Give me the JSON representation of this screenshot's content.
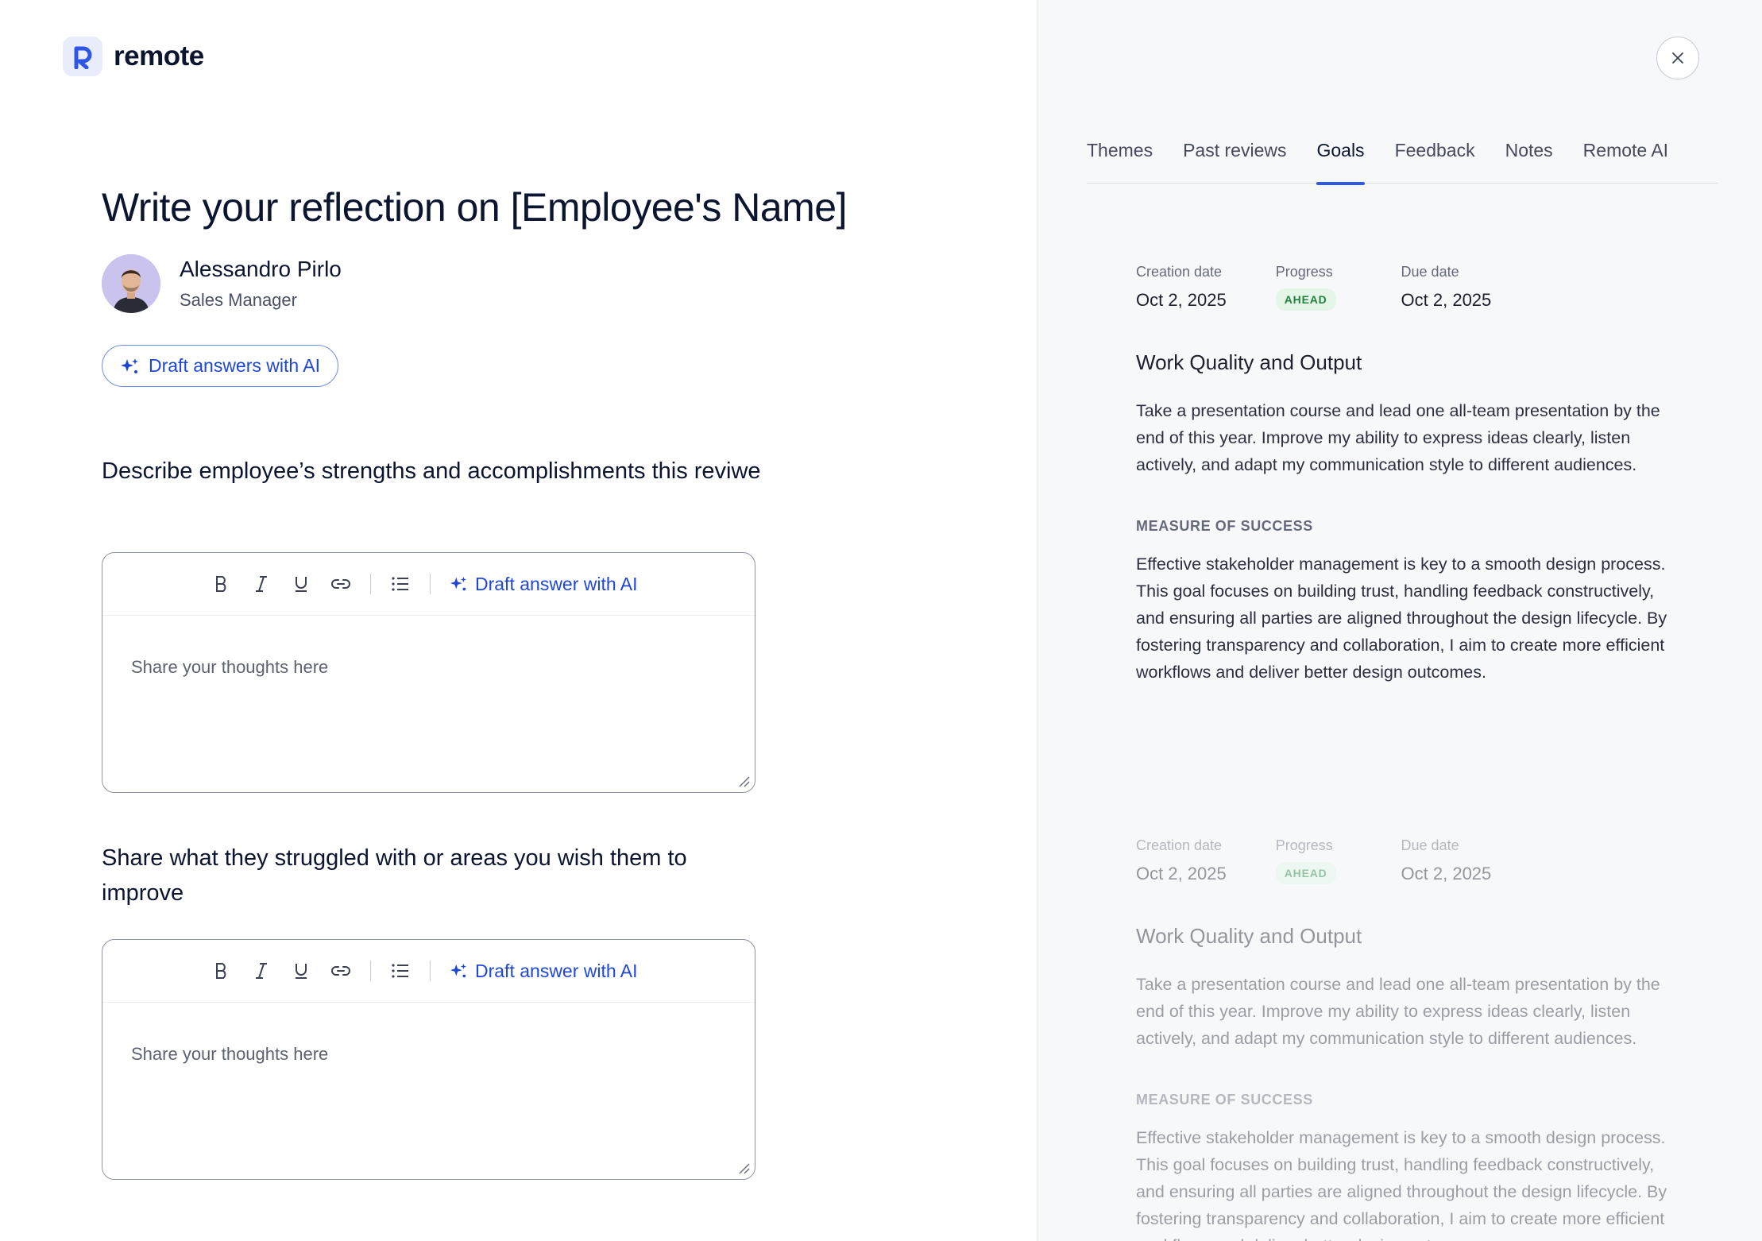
{
  "app": {
    "logo_text": "remote"
  },
  "page": {
    "title": "Write your reflection on [Employee's Name]"
  },
  "employee": {
    "name": "Alessandro Pirlo",
    "role": "Sales Manager"
  },
  "draft_all_button": {
    "label": "Draft answers with AI"
  },
  "questions": [
    {
      "text": "Describe employee’s strengths and accomplishments this reviwe",
      "editor": {
        "placeholder": "Share your thoughts here",
        "ai_label": "Draft answer with AI"
      }
    },
    {
      "text": "Share what they struggled with or areas you wish them to improve",
      "editor": {
        "placeholder": "Share your thoughts here",
        "ai_label": "Draft answer with AI"
      }
    }
  ],
  "side_panel": {
    "tabs": [
      {
        "label": "Themes",
        "active": false
      },
      {
        "label": "Past reviews",
        "active": false
      },
      {
        "label": "Goals",
        "active": true
      },
      {
        "label": "Feedback",
        "active": false
      },
      {
        "label": "Notes",
        "active": false
      },
      {
        "label": "Remote AI",
        "active": false
      }
    ],
    "goals": [
      {
        "creation_label": "Creation date",
        "creation_date": "Oct 2, 2025",
        "progress_label": "Progress",
        "progress_status": "AHEAD",
        "due_label": "Due date",
        "due_date": "Oct 2, 2025",
        "title": "Work Quality and Output",
        "description": "Take a presentation course and lead one all-team presentation by the end of this year.  Improve my ability to express ideas clearly, listen actively, and adapt my communication style to different audiences.",
        "measure_label": "MEASURE OF SUCCESS",
        "measure_text": "Effective stakeholder management is key to a smooth design process. This goal focuses on building trust, handling feedback constructively, and ensuring all parties are aligned throughout the design lifecycle. By fostering transparency and collaboration, I aim to create more efficient workflows and deliver better design outcomes."
      },
      {
        "creation_label": "Creation date",
        "creation_date": "Oct 2, 2025",
        "progress_label": "Progress",
        "progress_status": "AHEAD",
        "due_label": "Due date",
        "due_date": "Oct 2, 2025",
        "title": "Work Quality and Output",
        "description": "Take a presentation course and lead one all-team presentation by the end of this year.  Improve my ability to express ideas clearly, listen actively, and adapt my communication style to different audiences.",
        "measure_label": "MEASURE OF SUCCESS",
        "measure_text": "Effective stakeholder management is key to a smooth design process. This goal focuses on building trust, handling feedback constructively, and ensuring all parties are aligned throughout the design lifecycle. By fostering transparency and collaboration, I aim to create more efficient workflows and deliver better design outcomes."
      }
    ]
  },
  "colors": {
    "accent": "#1f47d6",
    "tab_indicator": "#2f5ae6",
    "badge_bg": "#e3f6e7",
    "badge_text": "#25813e",
    "panel_bg": "#f7f8fa"
  }
}
